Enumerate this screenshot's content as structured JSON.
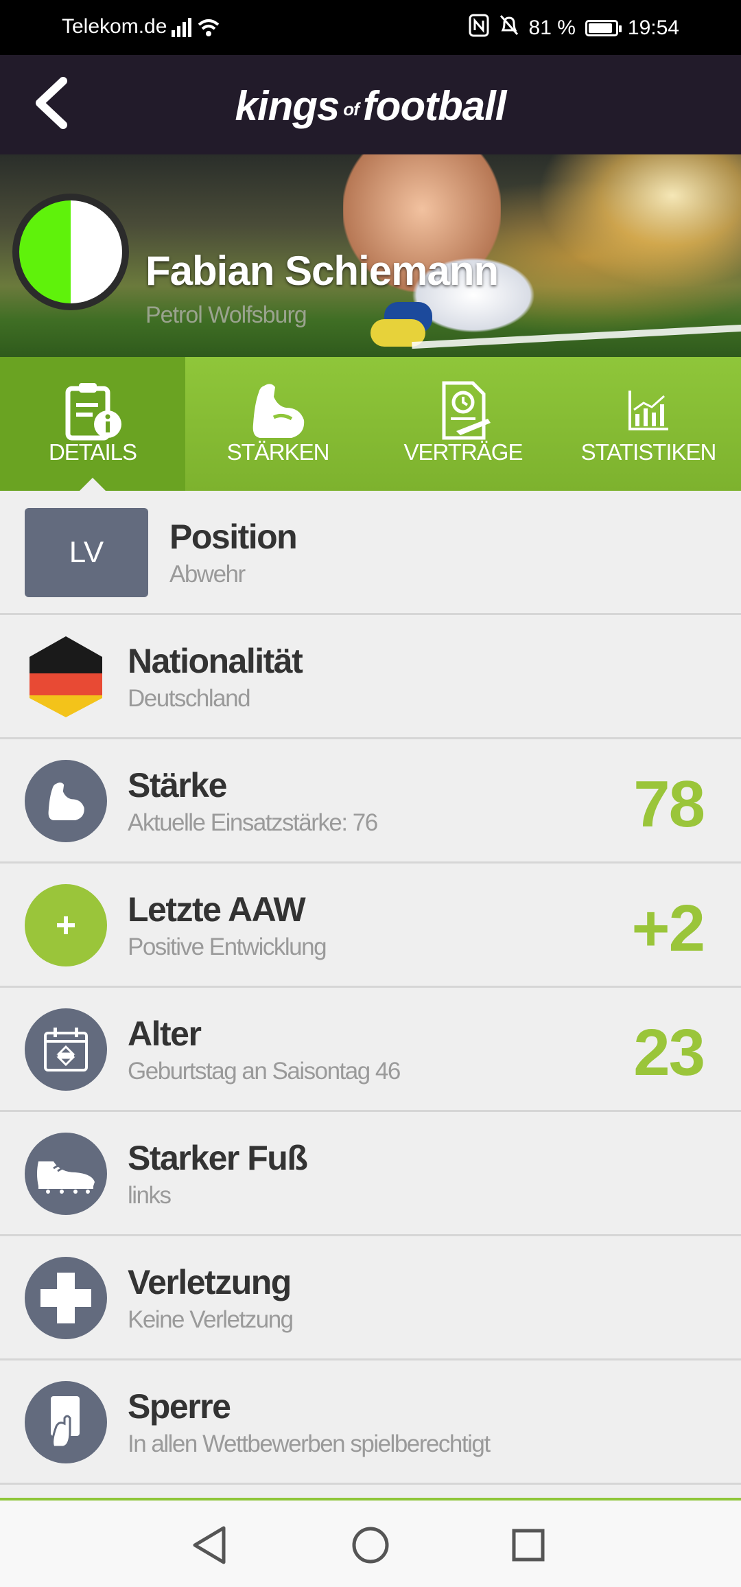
{
  "status_bar": {
    "carrier": "Telekom.de",
    "battery": "81 %",
    "time": "19:54"
  },
  "app": {
    "logo_left": "kings",
    "logo_of": "of",
    "logo_right": "football"
  },
  "player": {
    "name": "Fabian Schiemann",
    "club": "Petrol Wolfsburg",
    "avatar_colors": [
      "#5ff20b",
      "#ffffff"
    ]
  },
  "tabs": [
    {
      "label": "DETAILS",
      "icon": "details-icon",
      "active": true
    },
    {
      "label": "STÄRKEN",
      "icon": "muscle-icon",
      "active": false
    },
    {
      "label": "VERTRÄGE",
      "icon": "contract-icon",
      "active": false
    },
    {
      "label": "STATISTIKEN",
      "icon": "stats-icon",
      "active": false
    }
  ],
  "details": [
    {
      "key": "position",
      "badge": "LV",
      "title": "Position",
      "sub": "Abwehr",
      "value": ""
    },
    {
      "key": "nationality",
      "icon": "germany-flag-icon",
      "title": "Nationalität",
      "sub": "Deutschland",
      "value": ""
    },
    {
      "key": "strength",
      "icon": "muscle-icon",
      "title": "Stärke",
      "sub": "Aktuelle Einsatzstärke: 76",
      "value": "78"
    },
    {
      "key": "last_aaw",
      "icon": "plus-icon",
      "title": "Letzte AAW",
      "sub": "Positive Entwicklung",
      "value": "+2"
    },
    {
      "key": "age",
      "icon": "calendar-icon",
      "title": "Alter",
      "sub": "Geburtstag an Saisontag 46",
      "value": "23"
    },
    {
      "key": "foot",
      "icon": "boot-icon",
      "title": "Starker Fuß",
      "sub": "links",
      "value": ""
    },
    {
      "key": "injury",
      "icon": "cross-icon",
      "title": "Verletzung",
      "sub": "Keine Verletzung",
      "value": ""
    },
    {
      "key": "suspension",
      "icon": "card-icon",
      "title": "Sperre",
      "sub": "In allen Wettbewerben spielberechtigt",
      "value": ""
    }
  ],
  "colors": {
    "accent_green": "#9ac53a",
    "header_dark": "#221b2a",
    "icon_slate": "#636b7e"
  }
}
